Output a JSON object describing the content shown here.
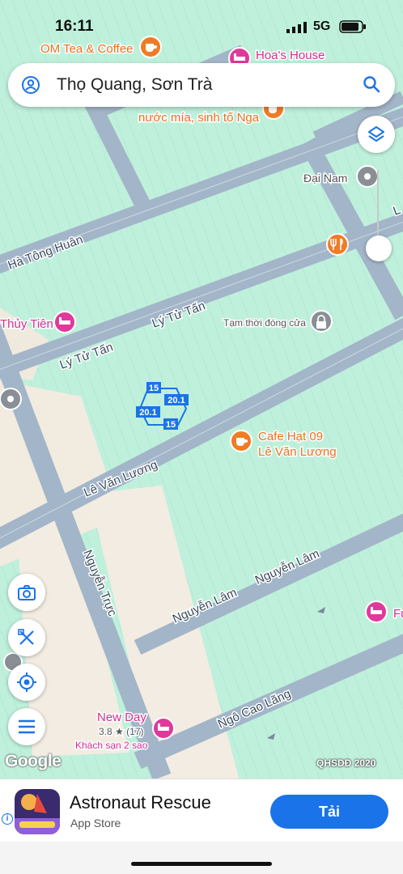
{
  "status": {
    "time": "16:11",
    "network": "5G"
  },
  "search": {
    "query": "Thọ Quang, Sơn Trà"
  },
  "map": {
    "streets": {
      "ha_tong_huan": "Hà Tông Huân",
      "ly_tu_tan_1": "Lý Tử Tấn",
      "ly_tu_tan_2": "Lý Tử Tấn",
      "le_van_luong": "Lê Văn Lương",
      "nguyen_truc": "Nguyễn Trực",
      "nguyen_lam_1": "Nguyễn Lâm",
      "nguyen_lam_2": "Nguyễn Lâm",
      "ngo_cao_lang": "Ngô Cao Lãng",
      "edge_right": "L"
    },
    "pois": {
      "om_tea": "OM Tea & Coffee",
      "hoas_house": "Hoa's House",
      "nuoc_mia": "nước mía, sinh tố Nga",
      "dai_nam": "Đại Nam",
      "thuy_tien": "Thủy Tiên",
      "tam_thoi": "Tạm thời đóng cửa",
      "cafe_name": "Cafe Hạt 09",
      "cafe_addr": "Lê Văn Lương",
      "new_day": "New Day",
      "new_day_rating": "3.8 ★ (17)",
      "new_day_type": "Khách sạn 2 sao",
      "fu": "Fu"
    },
    "lot": {
      "top": "15",
      "right": "20.1",
      "left": "20.1",
      "bottom": "15"
    },
    "google": "Google",
    "copyright": "QHSDĐ 2020"
  },
  "colors": {
    "map_bg": "#bff0dc",
    "road": "#a3b5c8",
    "sand": "#f3ece2",
    "accent": "#1a73e8",
    "poi_orange": "#f07c24",
    "poi_pink": "#e0399b",
    "poi_gray": "#8a8f96"
  },
  "icons": [
    "user-icon",
    "search-icon",
    "layers-icon",
    "camera-icon",
    "ruler-icon",
    "locate-icon",
    "menu-icon",
    "cafe-icon",
    "hotel-icon",
    "restaurant-icon",
    "lock-icon",
    "place-icon"
  ],
  "ad": {
    "title": "Astronaut Rescue",
    "subtitle": "App Store",
    "button": "Tải",
    "info": "i"
  }
}
